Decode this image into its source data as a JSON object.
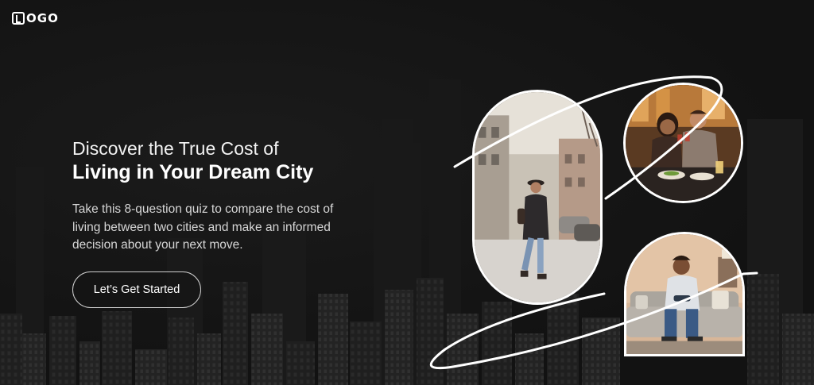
{
  "header": {
    "logo_text": "OGO"
  },
  "hero": {
    "headline_line1": "Discover the True Cost of",
    "headline_line2": "Living in Your Dream City",
    "description": "Take this 8-question quiz to compare the cost of living between two cities and make an informed decision about your next move.",
    "cta_label": "Let’s Get Started"
  },
  "collage": {
    "photos": [
      {
        "name": "street-walker-photo",
        "subject": "woman walking on city street"
      },
      {
        "name": "dining-couple-photo",
        "subject": "couple toasting at restaurant"
      },
      {
        "name": "gamer-photo",
        "subject": "man playing video games on sofa"
      }
    ]
  },
  "colors": {
    "background": "#141414",
    "text": "#ffffff",
    "muted_text": "#d6d6d6",
    "button_border": "#cfcfcf",
    "orbit_line": "#ffffff"
  }
}
